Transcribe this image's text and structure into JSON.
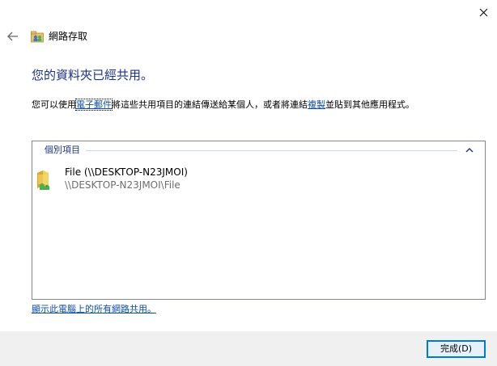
{
  "window": {
    "title": "網路存取",
    "close_glyph": "✕",
    "back_glyph": "←"
  },
  "main": {
    "headline": "您的資料夾已經共用。",
    "description_prefix": "您可以使用",
    "description_email_link": "電子郵件",
    "description_middle": "將這些共用項目的連結傳送給某個人，或者將連結",
    "description_copy_link": "複製",
    "description_suffix": "並貼到其他應用程式。"
  },
  "items_panel": {
    "group_label": "個別項目",
    "items": [
      {
        "name": "File (\\\\DESKTOP-N23JMOI)",
        "path": "\\\\DESKTOP-N23JMOI\\File"
      }
    ]
  },
  "links": {
    "show_all_shares": "顯示此電腦上的所有網路共用。"
  },
  "footer": {
    "finish_label": "完成(D)"
  },
  "colors": {
    "headline": "#1e3287",
    "link": "#0b4ea8",
    "footer_bg": "#f0f0f0",
    "button_border": "#0078d7"
  }
}
